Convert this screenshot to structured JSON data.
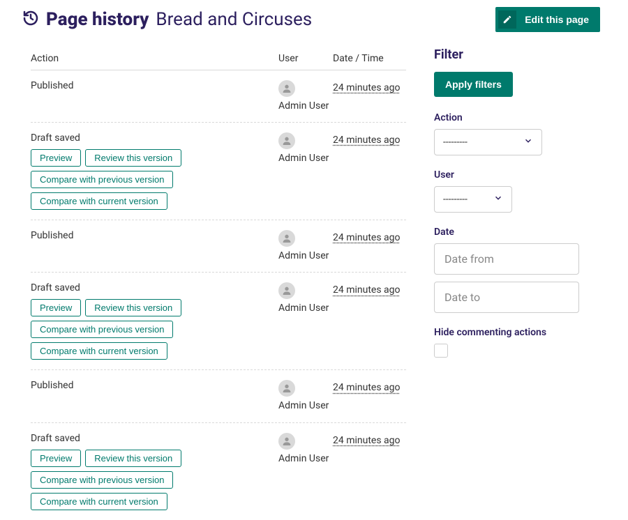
{
  "header": {
    "title": "Page history",
    "page_name": "Bread and Circuses",
    "edit_button": "Edit this page"
  },
  "table": {
    "headers": {
      "action": "Action",
      "user": "User",
      "date": "Date / Time"
    },
    "rows": [
      {
        "action": "Published",
        "user": "Admin User",
        "date": "24 minutes ago",
        "has_buttons": false
      },
      {
        "action": "Draft saved",
        "user": "Admin User",
        "date": "24 minutes ago",
        "has_buttons": true
      },
      {
        "action": "Published",
        "user": "Admin User",
        "date": "24 minutes ago",
        "has_buttons": false
      },
      {
        "action": "Draft saved",
        "user": "Admin User",
        "date": "24 minutes ago",
        "has_buttons": true
      },
      {
        "action": "Published",
        "user": "Admin User",
        "date": "24 minutes ago",
        "has_buttons": false
      },
      {
        "action": "Draft saved",
        "user": "Admin User",
        "date": "24 minutes ago",
        "has_buttons": true
      }
    ],
    "buttons": {
      "preview": "Preview",
      "review": "Review this version",
      "compare_prev": "Compare with previous version",
      "compare_curr": "Compare with current version"
    }
  },
  "filter": {
    "title": "Filter",
    "apply": "Apply filters",
    "action_label": "Action",
    "action_value": "---------",
    "user_label": "User",
    "user_value": "---------",
    "date_label": "Date",
    "date_from_placeholder": "Date from",
    "date_to_placeholder": "Date to",
    "hide_comments_label": "Hide commenting actions"
  }
}
